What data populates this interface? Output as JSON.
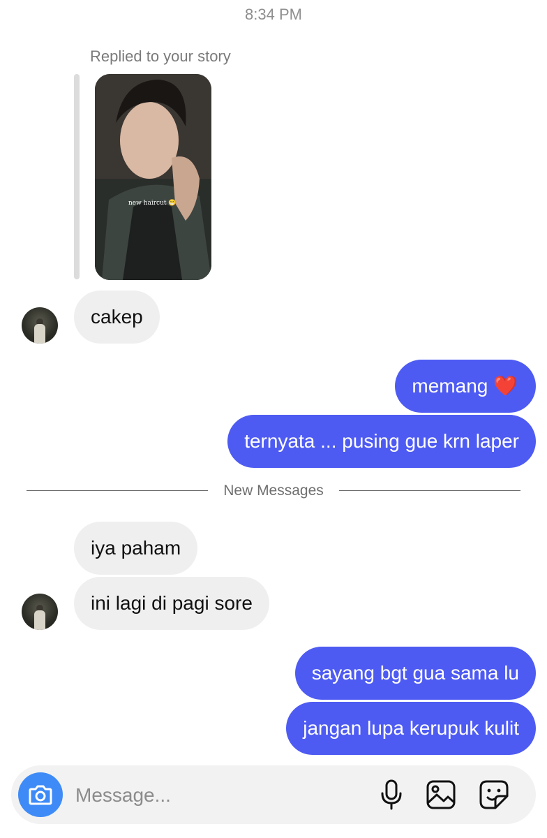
{
  "header": {
    "time": "8:34 PM"
  },
  "story_reply": {
    "label": "Replied to your story",
    "caption": "new haircut 😁"
  },
  "messages": [
    {
      "id": "m1",
      "direction": "incoming",
      "text": "cakep"
    },
    {
      "id": "m2",
      "direction": "outgoing",
      "text": "memang ❤️"
    },
    {
      "id": "m3",
      "direction": "outgoing",
      "text": "ternyata ... pusing gue krn laper"
    },
    {
      "id": "m4",
      "direction": "incoming",
      "text": "iya paham"
    },
    {
      "id": "m5",
      "direction": "incoming",
      "text": "ini lagi di pagi sore"
    },
    {
      "id": "m6",
      "direction": "outgoing",
      "text": "sayang bgt gua sama lu"
    },
    {
      "id": "m7",
      "direction": "outgoing",
      "text": "jangan lupa kerupuk kulit"
    }
  ],
  "divider": {
    "label": "New Messages"
  },
  "composer": {
    "placeholder": "Message...",
    "icons": [
      "camera-icon",
      "microphone-icon",
      "gallery-icon",
      "sticker-icon"
    ]
  },
  "colors": {
    "outgoing_bubble": "#4e5bf2",
    "incoming_bubble": "#efefef",
    "camera_button": "#3e8bf7"
  }
}
